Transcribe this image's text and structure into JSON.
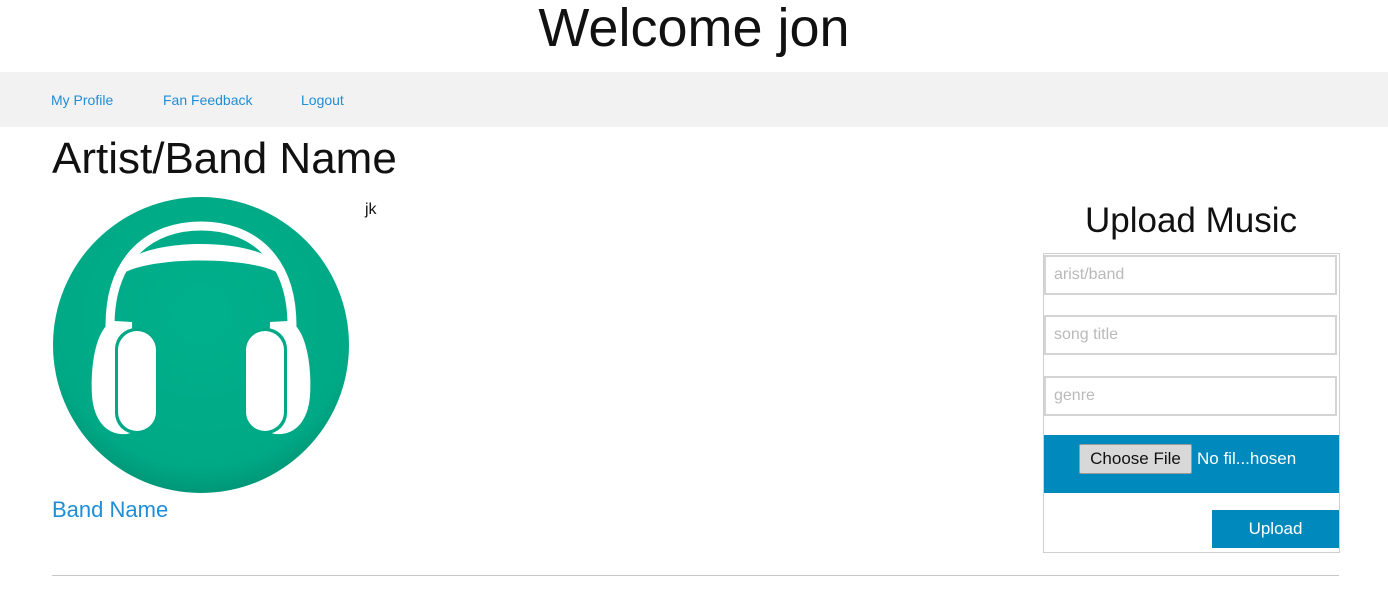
{
  "header": {
    "welcome": "Welcome jon"
  },
  "nav": {
    "items": [
      {
        "label": "My Profile"
      },
      {
        "label": "Fan Feedback"
      },
      {
        "label": "Logout"
      }
    ]
  },
  "profile": {
    "title": "Artist/Band Name",
    "note": "jk",
    "band_name_link": "Band Name",
    "avatar_icon": "headphones-icon",
    "avatar_color": "#00aa86"
  },
  "upload": {
    "title": "Upload Music",
    "fields": [
      {
        "placeholder": "arist/band",
        "value": ""
      },
      {
        "placeholder": "song title",
        "value": ""
      },
      {
        "placeholder": "genre",
        "value": ""
      }
    ],
    "choose_file_label": "Choose File",
    "file_status": "No fil...hosen",
    "submit_label": "Upload",
    "accent_color": "#0089bd"
  }
}
